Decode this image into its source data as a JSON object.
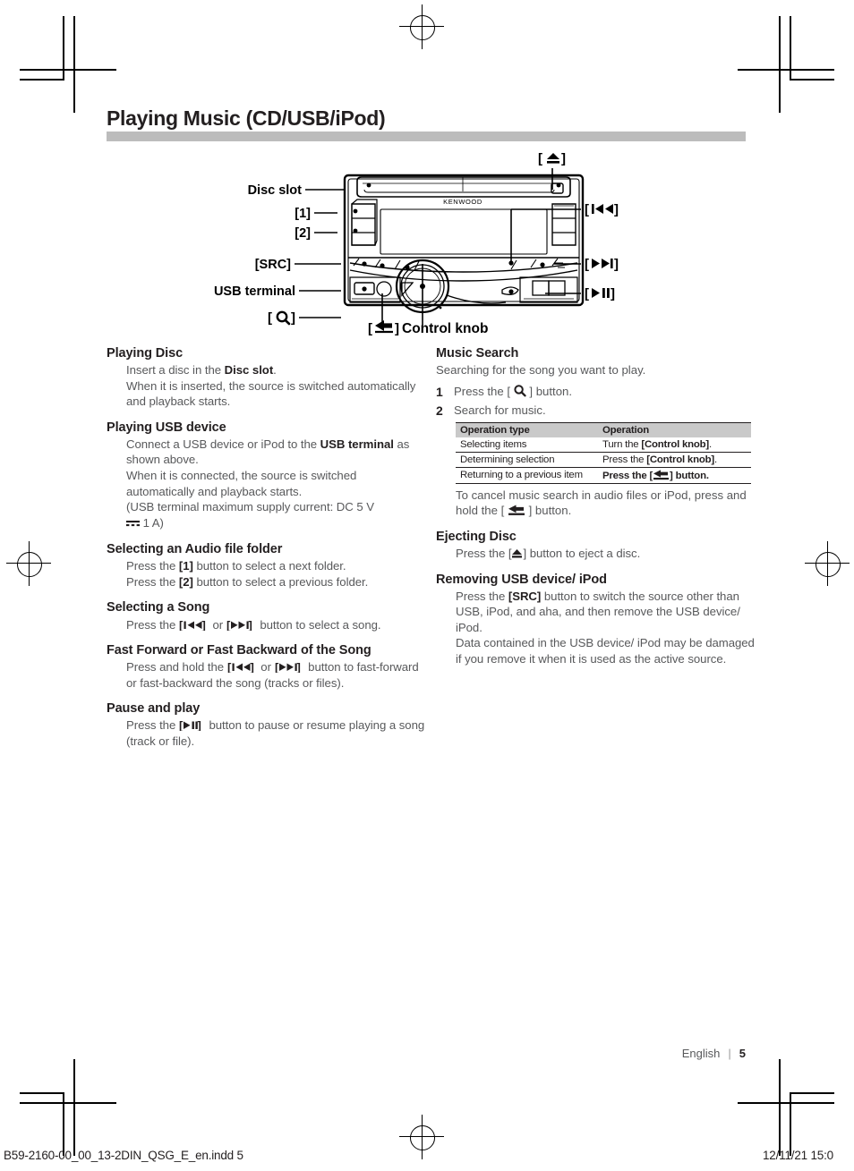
{
  "document": {
    "title": "Playing Music (CD/USB/iPod)",
    "footer": {
      "language": "English",
      "separator": "|",
      "page_number": "5",
      "print_filename": "B59-2160-00_00_13-2DIN_QSG_E_en.indd   5",
      "print_timestamp": "12/11/21   15:0"
    }
  },
  "diagram": {
    "brand": "KENWOOD",
    "labels": {
      "disc_slot": "Disc slot",
      "button_1": "[1]",
      "button_2": "[2]",
      "src": "[SRC]",
      "usb_terminal": "USB terminal",
      "search": "[",
      "search_close": "]",
      "eject": "[",
      "eject_close": "]",
      "prev_track": "[",
      "prev_track_close": "]",
      "next_track": "[",
      "next_track_close": "]",
      "play_pause": "[",
      "play_pause_close": "]",
      "back": "[",
      "back_close": "]",
      "control_knob": "Control knob"
    }
  },
  "left_column": {
    "sections": [
      {
        "heading": "Playing Disc",
        "lines": [
          "Insert a disc in the Disc slot.",
          "When it is inserted, the source is switched automatically and playback starts."
        ]
      },
      {
        "heading": "Playing USB device",
        "lines": [
          "Connect a USB device or iPod to the USB terminal as shown above.",
          "When it is connected, the source is switched automatically and playback starts.",
          "(USB terminal maximum supply current: DC 5 V 1 A)"
        ]
      },
      {
        "heading": "Selecting an Audio file folder",
        "lines": [
          "Press the [1] button to select a next folder.",
          "Press the [2] button to select a previous folder."
        ]
      },
      {
        "heading": "Selecting a Song",
        "lines": [
          "Press the [|◄◄] or [►►|] button to select a song."
        ]
      },
      {
        "heading": "Fast Forward or Fast Backward of the Song",
        "lines": [
          "Press and hold the [|◄◄] or [►►|] button to fast-forward or fast-backward the song (tracks or files)."
        ]
      },
      {
        "heading": "Pause and play",
        "lines": [
          "Press the [►II] button to pause or resume playing a song (track or file)."
        ]
      }
    ],
    "text_fragments": {
      "playing_disc_l1_a": "Insert a disc in the ",
      "playing_disc_l1_b": "Disc slot",
      "playing_disc_l1_c": ".",
      "playing_disc_l2": "When it is inserted, the source is switched automatically and playback starts.",
      "usb_l1_a": "Connect a USB device or iPod to the ",
      "usb_l1_b": "USB terminal",
      "usb_l1_c": " as shown above.",
      "usb_l2": "When it is connected, the source is switched automatically and playback starts.",
      "usb_l3_a": "(USB terminal maximum supply current: DC 5 V",
      "usb_l3_b": " 1 A)",
      "folder_l1_a": "Press the ",
      "folder_l1_b": "[1]",
      "folder_l1_c": " button to select a next folder.",
      "folder_l2_a": "Press the ",
      "folder_l2_b": "[2]",
      "folder_l2_c": " button to select a previous folder.",
      "song_l1_a": "Press the ",
      "song_l1_b": " or ",
      "song_l1_c": " button to select a song.",
      "ff_l1_a": "Press and hold the ",
      "ff_l1_b": " or ",
      "ff_l1_c": " button to fast-forward or fast-backward the song (tracks or files).",
      "pause_l1_a": "Press the ",
      "pause_l1_b": " button to pause or resume playing a song (track or file)."
    }
  },
  "right_column": {
    "music_search": {
      "heading": "Music Search",
      "lead": "Searching for the song you want to play.",
      "steps": [
        {
          "num": "1",
          "text_a": "Press the [ ",
          "text_b": " ] button."
        },
        {
          "num": "2",
          "text_a": "Search for music.",
          "text_b": ""
        }
      ],
      "table": {
        "headers": [
          "Operation type",
          "Operation"
        ],
        "rows": [
          {
            "type": "Selecting items",
            "op_a": "Turn the ",
            "op_b": "[Control knob]",
            "op_c": "."
          },
          {
            "type": "Determining selection",
            "op_a": "Press the ",
            "op_b": "[Control knob]",
            "op_c": "."
          },
          {
            "type": "Returning to a previous item",
            "op_a": "Press the [",
            "op_b": "",
            "op_c": "] button."
          }
        ]
      },
      "note_a": "To cancel music search in audio files or iPod, press and hold the [ ",
      "note_b": " ] button."
    },
    "ejecting_disc": {
      "heading": "Ejecting Disc",
      "line_a": "Press the [",
      "line_b": "] button to eject a disc."
    },
    "removing_usb": {
      "heading": "Removing USB device/ iPod",
      "line1_a": "Press the ",
      "line1_b": "[SRC]",
      "line1_c": " button to switch the source other than USB, iPod, and aha, and then remove the USB device/ iPod.",
      "line2": "Data contained in the USB device/ iPod may be damaged if you remove it when it is used as the active source."
    }
  },
  "colors": {
    "title_rule": "#bcbcbc",
    "body_text": "#58595b",
    "heading_text": "#231f20",
    "table_header_bg": "#c9c9c9"
  }
}
